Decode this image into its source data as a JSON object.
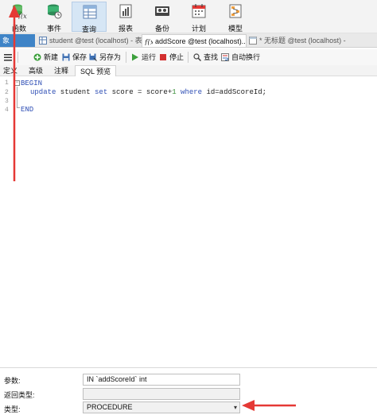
{
  "toolbar": {
    "buttons": [
      {
        "label": "函数",
        "icon": "function-icon"
      },
      {
        "label": "事件",
        "icon": "event-icon"
      },
      {
        "label": "查询",
        "icon": "query-icon"
      },
      {
        "label": "报表",
        "icon": "report-icon"
      },
      {
        "label": "备份",
        "icon": "backup-icon"
      },
      {
        "label": "计划",
        "icon": "schedule-icon"
      },
      {
        "label": "模型",
        "icon": "model-icon"
      }
    ],
    "active": "查询"
  },
  "tabs": [
    {
      "label": "象"
    },
    {
      "label": "student @test (localhost) - 表"
    },
    {
      "label": "addScore @test (localhost)..."
    },
    {
      "label": "* 无标题 @test (localhost) -"
    }
  ],
  "editor_toolbar": {
    "new": "新建",
    "save": "保存",
    "save_as": "另存为",
    "run": "运行",
    "stop": "停止",
    "find": "查找",
    "autowrap": "自动换行"
  },
  "sub_tabs": [
    "定义",
    "高级",
    "注释",
    "SQL 预览"
  ],
  "code": {
    "line_numbers": [
      "1",
      "2",
      "3",
      "4"
    ],
    "line1": "BEGIN",
    "line2": {
      "kw1": "update",
      "t1": " student ",
      "kw2": "set",
      "t2": " score = score+",
      "num": "1",
      "t3": " ",
      "kw3": "where",
      "t4": " id=addScoreId;"
    },
    "line4": "END"
  },
  "properties": {
    "param_label": "参数:",
    "param_value": "IN `addScoreId` int",
    "return_label": "返回类型:",
    "return_value": "",
    "type_label": "类型:",
    "type_value": "PROCEDURE"
  },
  "colors": {
    "annotation": "#e53935",
    "tab_active_blue": "#3f84c7",
    "keyword": "#2f4fb5"
  }
}
